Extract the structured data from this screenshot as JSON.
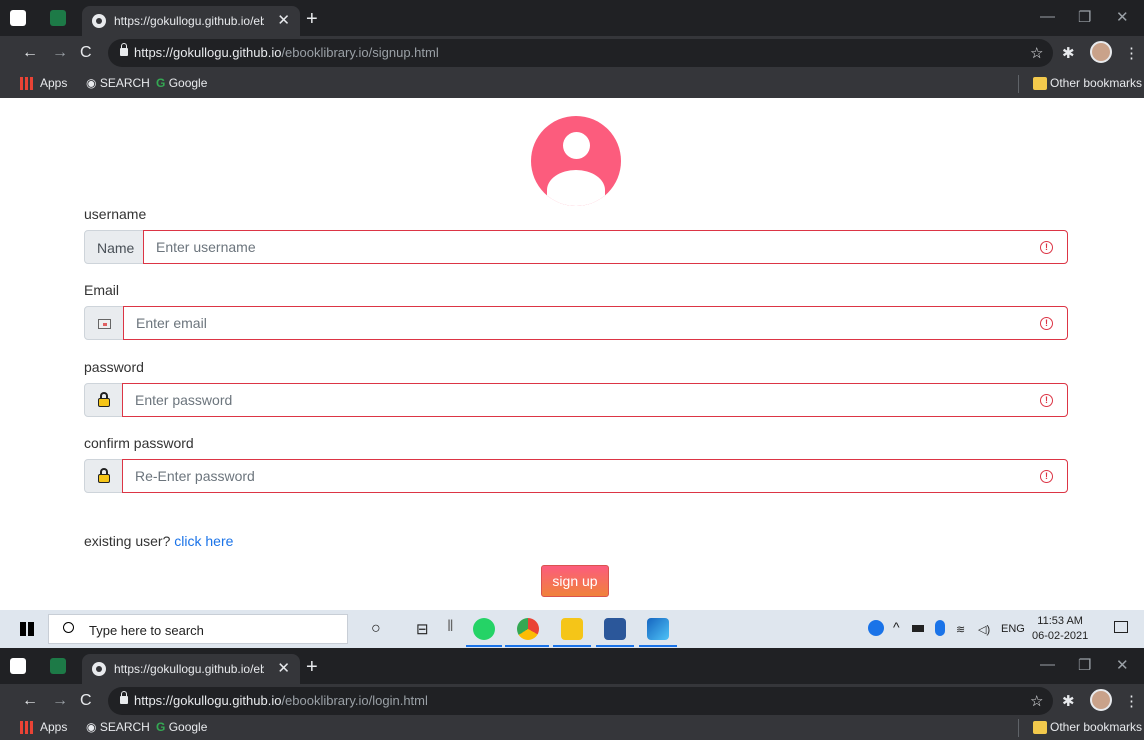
{
  "browser": {
    "tab_title": "https://gokullogu.github.io/eboo",
    "url_host": "https://gokullogu.github.io",
    "url_path": "/ebooklibrary.io/signup.html",
    "bookmarks": {
      "apps": "Apps",
      "search": "SEARCH",
      "google": "Google",
      "other": "Other bookmarks"
    }
  },
  "form": {
    "username": {
      "label": "username",
      "addon": "Name",
      "placeholder": "Enter username"
    },
    "email": {
      "label": "Email",
      "placeholder": "Enter email"
    },
    "password": {
      "label": "password",
      "placeholder": "Enter password"
    },
    "confirm": {
      "label": "confirm password",
      "placeholder": "Re-Enter password"
    },
    "existing_text": "existing user?",
    "existing_link": "click here",
    "submit_label": "sign up"
  },
  "taskbar": {
    "search_placeholder": "Type here to search",
    "lang": "ENG",
    "time": "11:53 AM",
    "date": "06-02-2021"
  },
  "browser2": {
    "tab_title": "https://gokullogu.github.io/eboo",
    "url_host": "https://gokullogu.github.io",
    "url_path": "/ebooklibrary.io/login.html",
    "bookmarks": {
      "apps": "Apps",
      "search": "SEARCH",
      "google": "Google",
      "other": "Other bookmarks"
    }
  },
  "colors": {
    "accent": "#fc5c7d",
    "error": "#dc3545",
    "link": "#1a73e8"
  }
}
